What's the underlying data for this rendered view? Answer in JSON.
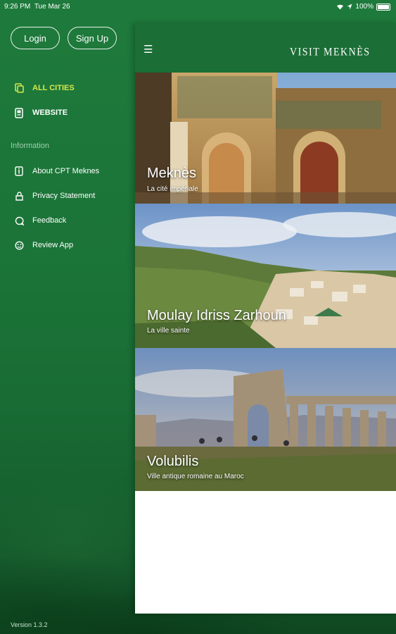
{
  "status": {
    "time": "9:26 PM",
    "date": "Tue Mar 26",
    "battery": "100%"
  },
  "auth": {
    "login": "Login",
    "signup": "Sign Up"
  },
  "nav": {
    "main": [
      {
        "label": "ALL CITIES",
        "icon": "cities-icon"
      },
      {
        "label": "WEBSITE",
        "icon": "website-icon"
      }
    ],
    "section_title": "Information",
    "info": [
      {
        "label": "About CPT Meknes",
        "icon": "about-icon"
      },
      {
        "label": "Privacy Statement",
        "icon": "privacy-icon"
      },
      {
        "label": "Feedback",
        "icon": "feedback-icon"
      },
      {
        "label": "Review App",
        "icon": "review-icon"
      }
    ]
  },
  "version": "Version 1.3.2",
  "header": {
    "title": "VISIT MEKNÈS",
    "menu_icon": "hamburger-icon"
  },
  "cities": [
    {
      "name": "Meknès",
      "subtitle": "La cité impériale"
    },
    {
      "name": "Moulay Idriss Zarhoun",
      "subtitle": "La ville sainte"
    },
    {
      "name": "Volubilis",
      "subtitle": "Ville antique romaine au Maroc"
    }
  ],
  "colors": {
    "sidebar_green": "#1e7a3c",
    "header_green": "#1b6e36",
    "active": "#d7e84a"
  }
}
